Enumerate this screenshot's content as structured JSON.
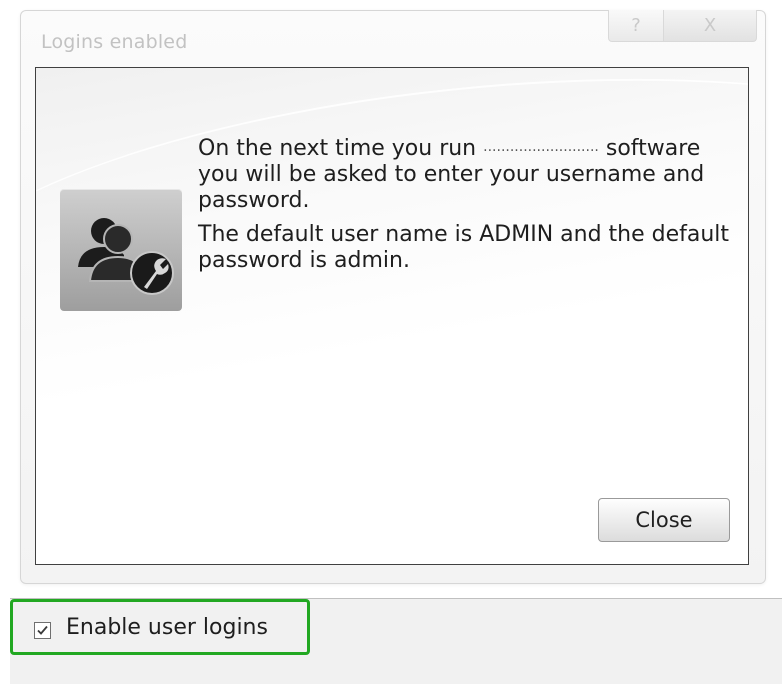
{
  "dialog": {
    "title": "Logins enabled",
    "help_glyph": "?",
    "close_glyph": "X"
  },
  "message": {
    "line1_prefix": "On the next time you run",
    "line1_dots": "..........................",
    "line1_rest": "software you will be asked to enter your username and password.",
    "line2": "The default user name is ADMIN and the default password is admin."
  },
  "buttons": {
    "close_label": "Close"
  },
  "option": {
    "checked": true,
    "label": "Enable user logins"
  },
  "icons": {
    "users": "users-wrench-icon",
    "help": "help-icon",
    "close": "close-icon",
    "check": "check-icon"
  },
  "colors": {
    "highlight": "#22a822"
  }
}
